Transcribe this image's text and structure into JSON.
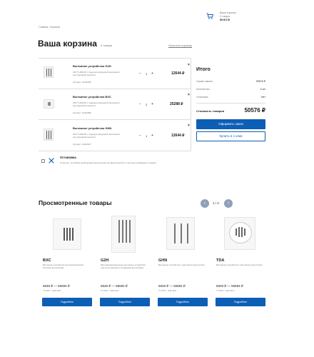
{
  "header": {
    "cart_line1": "Ваша корзина",
    "cart_line2": "4 товара",
    "cart_line3": "65 872 ₽",
    "icon": "cart-icon"
  },
  "breadcrumb": [
    "Главная",
    "Корзина"
  ],
  "page": {
    "title": "Ваша корзина",
    "count": "4 товара",
    "clear": "Очистить корзину"
  },
  "cart_items": [
    {
      "name": "Вытяжное устройство G2H",
      "desc": "LB-TY-A80-60 с гидрорегулируемой заслонкой / регулировкой скорости",
      "article": "Артикул: G2H3033",
      "qty": "1",
      "price": "12644 ₽"
    },
    {
      "name": "Вытяжное устройство BXC",
      "desc": "LB-TY-A80-60 с гидрорегулируемой заслонкой / регулировкой скорости",
      "article": "Артикул: G2H3066",
      "qty": "2",
      "price": "25288 ₽"
    },
    {
      "name": "Вытяжное устройство GHN",
      "desc": "LB-TY-A80-60 с гидрорегулируемой заслонкой / регулировкой скорости",
      "article": "Артикул: G2H3047",
      "qty": "1",
      "price": "12644 ₽"
    }
  ],
  "install": {
    "title": "Установка",
    "desc": "Отметьте, если Вам необходима консультация профессионалов от местных выбранных товаров"
  },
  "summary": {
    "title": "Итого",
    "rows": [
      {
        "label": "Сумма заказа",
        "value": "50576 ₽"
      },
      {
        "label": "Количество",
        "value": "4 шт"
      },
      {
        "label": "Установка",
        "value": "Нет"
      }
    ],
    "total_label": "Стоимость товаров",
    "total_value": "50576 ₽",
    "order_button": "Оформить заказ",
    "oneclick_button": "Купить в 1 клик"
  },
  "viewed": {
    "title": "Просмотренные товары",
    "pager": "1 / 4",
    "items": [
      {
        "name": "BXC",
        "desc": "Вытяжное устройство для механической системы вентиляции",
        "price": "6848 ₽ — 56584 ₽",
        "price_eur": "77.60 € – 642.46 €",
        "button": "Подробнее"
      },
      {
        "name": "G2H",
        "desc": "Многофункциональное вытяжное устройство для естественной и гибридной вентиляции",
        "price": "6848 ₽ — 56584 ₽",
        "price_eur": "77.60 € – 642.46 €",
        "button": "Подробнее"
      },
      {
        "name": "GHN",
        "desc": "Вытяжное устройство с датчиком присутствия",
        "price": "6848 ₽ — 56584 ₽",
        "price_eur": "77.60 € – 642.46 €",
        "button": "Подробнее"
      },
      {
        "name": "TDA",
        "desc": "Вытяжное устройство с датчиком присутствия",
        "price": "6848 ₽ — 56584 ₽",
        "price_eur": "77.60 € – 642.46 €",
        "button": "Подробнее"
      }
    ]
  },
  "colors": {
    "accent": "#0d5eb5",
    "muted": "#777777",
    "border": "#dcdcdc"
  }
}
